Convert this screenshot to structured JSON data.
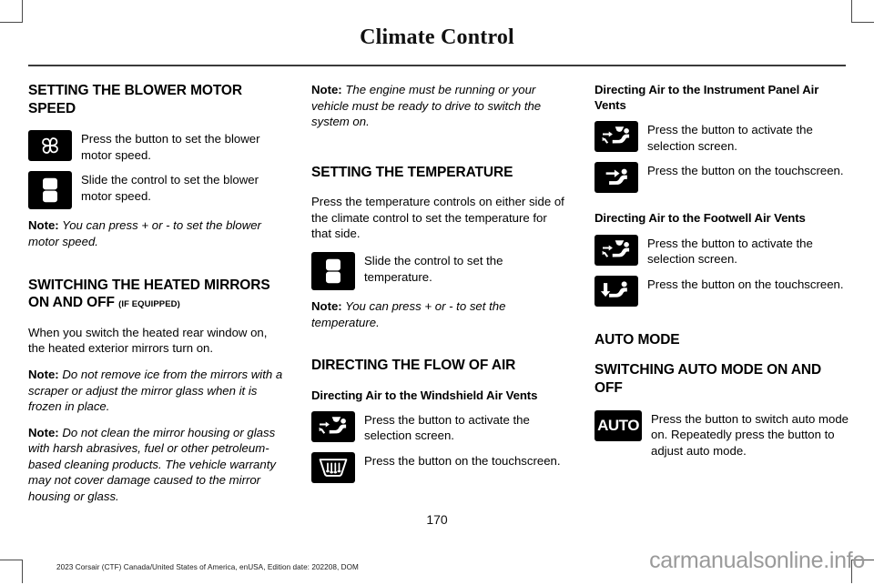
{
  "header": {
    "title": "Climate Control"
  },
  "columns": {
    "left": {
      "heading_blower": "SETTING THE BLOWER MOTOR SPEED",
      "row_fan": {
        "icon": "fan-icon",
        "text": "Press the button to set the blower motor speed."
      },
      "row_slider": {
        "icon": "rocker-slider-icon",
        "text": "Slide the control to set the blower motor speed."
      },
      "note_blower_label": "Note:",
      "note_blower_text": " You can press + or - to set the blower motor speed.",
      "heading_mirrors": "SWITCHING THE HEATED MIRRORS ON AND OFF",
      "heading_mirrors_suffix": "(IF EQUIPPED)",
      "para_mirrors": "When you switch the heated rear window on, the heated exterior mirrors turn on.",
      "note_mirror1_label": "Note:",
      "note_mirror1_text": " Do not remove ice from the mirrors with a scraper or adjust the mirror glass when it is frozen in place.",
      "note_mirror2_label": "Note:",
      "note_mirror2_text": " Do not clean the mirror housing or glass with harsh abrasives, fuel or other petroleum-based cleaning products. The vehicle warranty may not cover damage caused to the mirror housing or glass."
    },
    "middle": {
      "note_engine_label": "Note:",
      "note_engine_text": " The engine must be running or your vehicle must be ready to drive to switch the system on.",
      "heading_temperature": "SETTING THE TEMPERATURE",
      "para_temperature": "Press the temperature controls on either side of the climate control to set the temperature for that side.",
      "row_slider": {
        "icon": "rocker-slider-icon",
        "text": "Slide the control to set the temperature."
      },
      "note_temp_label": "Note:",
      "note_temp_text": " You can press + or - to set the temperature.",
      "heading_flow": "DIRECTING THE FLOW OF AIR",
      "heading_windshield": "Directing Air to the Windshield Air Vents",
      "row_select": {
        "icon": "seat-airflow-select-icon",
        "text": "Press the button to activate the selection screen."
      },
      "row_defrost": {
        "icon": "windshield-defrost-icon",
        "text": "Press the button on the touchscreen."
      }
    },
    "right": {
      "heading_panel": "Directing Air to the Instrument Panel Air Vents",
      "panel_row_select": {
        "icon": "seat-airflow-select-icon",
        "text": "Press the button to activate the selection screen."
      },
      "panel_row_vent": {
        "icon": "seat-panel-vent-icon",
        "text": "Press the button on the touchscreen."
      },
      "heading_footwell": "Directing Air to the Footwell Air Vents",
      "footwell_row_select": {
        "icon": "seat-airflow-select-icon",
        "text": "Press the button to activate the selection screen."
      },
      "footwell_row_vent": {
        "icon": "seat-footwell-vent-icon",
        "text": "Press the button on the touchscreen."
      },
      "heading_auto_mode": "AUTO MODE",
      "heading_auto_switch": "SWITCHING AUTO MODE ON AND OFF",
      "auto_row": {
        "icon": "auto-button-icon",
        "label": "AUTO",
        "text": "Press the button to switch auto mode on. Repeatedly press the button to adjust auto mode."
      }
    }
  },
  "footer": {
    "page_number": "170",
    "edition": "2023 Corsair (CTF) Canada/United States of America, enUSA, Edition date: 202208, DOM",
    "watermark": "carmanualsonline.info"
  }
}
